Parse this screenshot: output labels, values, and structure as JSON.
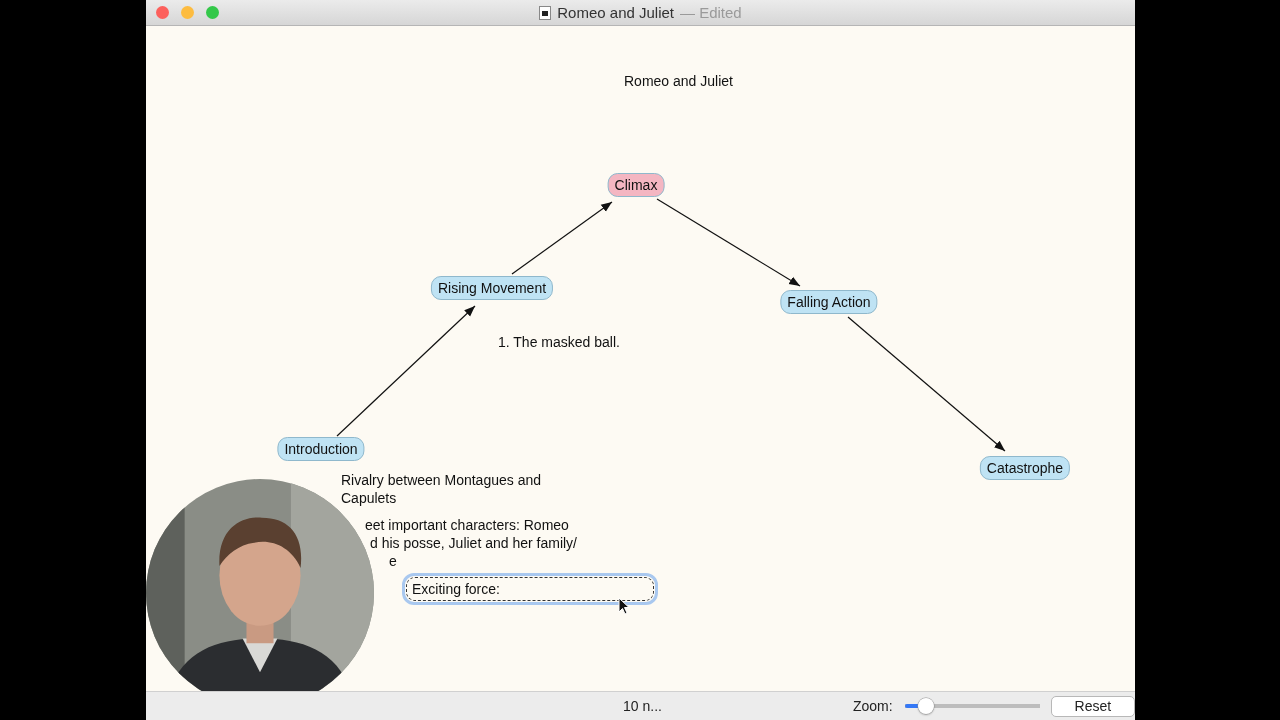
{
  "window": {
    "title": "Romeo and Juliet",
    "status": "— Edited"
  },
  "canvas": {
    "heading": "Romeo and Juliet",
    "nodes": [
      {
        "label": "Climax",
        "color": "#f4b6c2"
      },
      {
        "label": "Rising Movement",
        "color": "#bfe3f4"
      },
      {
        "label": "Falling Action",
        "color": "#bfe3f4"
      },
      {
        "label": "Introduction",
        "color": "#bfe3f4"
      },
      {
        "label": "Catastrophe",
        "color": "#bfe3f4"
      }
    ],
    "notes": [
      {
        "lines": [
          "1. The masked ball."
        ]
      },
      {
        "lines": [
          "Rivalry between Montagues and Capulets"
        ]
      },
      {
        "lines": [
          "eet important characters: Romeo",
          "d his posse, Juliet and her family/",
          "e"
        ]
      }
    ],
    "edit_field": {
      "value": "Exciting force:"
    }
  },
  "status_bar": {
    "count": "10 n...",
    "zoom_label": "Zoom:",
    "zoom": {
      "level": 0.16
    },
    "reset_button": "Reset"
  }
}
